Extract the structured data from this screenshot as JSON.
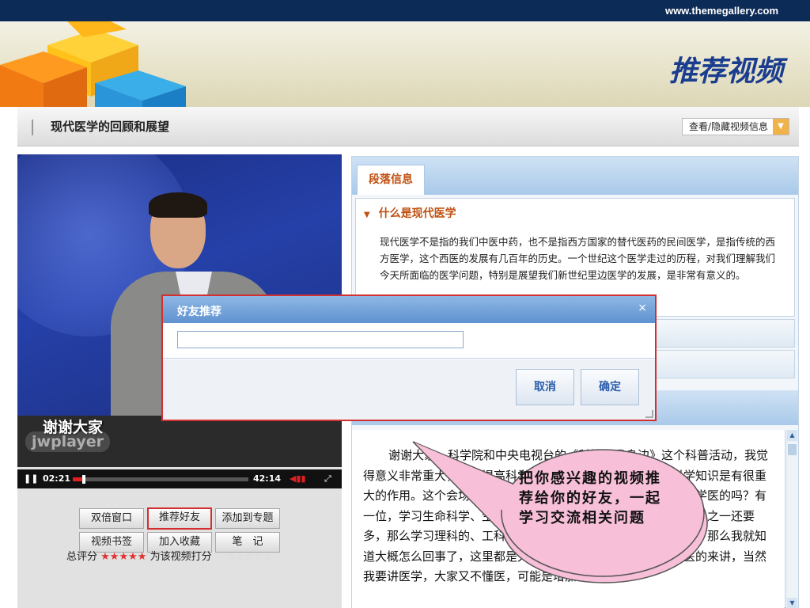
{
  "slide": {
    "website": "www.themegallery.com",
    "title": "推荐视频"
  },
  "header": {
    "video_title": "现代医学的回顾和展望",
    "toggle_label": "查看/隐藏视频信息"
  },
  "player": {
    "caption": "谢谢大家",
    "watermark": "jwplayer",
    "current_time": "02:21",
    "duration": "42:14",
    "progress": 0.056
  },
  "actions": {
    "double_window": "双倍窗口",
    "recommend_friend": "推荐好友",
    "add_to_topic": "添加到专题",
    "video_bookmark": "视频书签",
    "add_favorite": "加入收藏",
    "notes": "笔　记"
  },
  "rating": {
    "label": "总评分",
    "stars": "★★★★★",
    "rate_label": "为该视频打分",
    "empty_stars": "☆☆☆☆☆"
  },
  "info_panel": {
    "tab": "段落信息",
    "section_title": "什么是现代医学",
    "section_body": "现代医学不是指的我们中医中药，也不是指西方国家的替代医药的民间医学，是指传统的西方医学，这个西医的发展有几百年的历史。一个世纪这个医学走过的历程，对我们理解我们今天所面临的医学问题，特别是展望我们新世纪里边医学的发展，是非常有意义的。",
    "transcript": "谢谢大家。科学院和中央电视台的《科技在我身边》这个科普活动，我觉得意义非常重大，对于提高科学素质、弘扬科学精神、传播科学知识是有很重大的作用。这个会场里面，我们做过调查，好不好，我们这里有学医的吗？有一位，学习生命科学、生物学的，大概有二十多位，大概是有三分之一还要多，那么学习理科的、工科的，有吗？有几个学生，好好，谢谢，那么我就知道大概怎么回事了，这里都是大学生，所以我就当大家都不懂医的来讲，当然我要讲医学，大家又不懂医，可能是增加一点难度。"
  },
  "dialog": {
    "title": "好友推荐",
    "close": "×",
    "input_value": "",
    "cancel": "取消",
    "confirm": "确定"
  },
  "callout": {
    "text": "把你感兴趣的视频推荐给你的好友，一起学习交流相关问题"
  },
  "colors": {
    "topbar": "#0d2b57",
    "title": "#1a3d8f",
    "accent_red": "#d23030",
    "callout_fill": "#f8bfd8",
    "section_orange": "#c05010"
  }
}
